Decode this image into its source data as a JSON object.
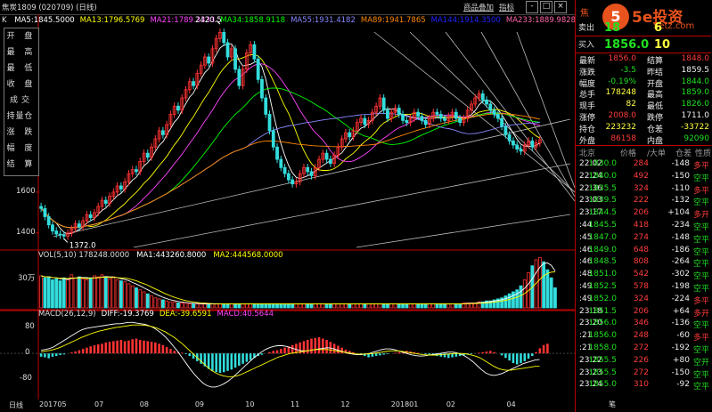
{
  "title_bar": {
    "symbol_label": "焦炭1809 (020709) (日线)",
    "right_links": [
      "商品叠加",
      "指标"
    ],
    "win_buttons": [
      "-",
      "□",
      "×"
    ]
  },
  "ma_legend": {
    "label": "K",
    "items": [
      {
        "text": "MA5:1845.5000",
        "color": "#ffffff"
      },
      {
        "text": "MA13:1796.5769",
        "color": "#ffff00"
      },
      {
        "text": "MA21:1789.3333",
        "color": "#ff44ff"
      },
      {
        "text": "MA34:1858.9118",
        "color": "#00ff00"
      },
      {
        "text": "MA55:1931.4182",
        "color": "#8888ff"
      },
      {
        "text": "MA89:1941.7865",
        "color": "#ff8800"
      },
      {
        "text": "MA144:1914.3500",
        "color": "#2222ff"
      },
      {
        "text": "MA233:1889.9828",
        "color": "#ff66aa"
      }
    ]
  },
  "left_menu": [
    "开 盘",
    "最 高",
    "最 低",
    "收 盘",
    "成交量",
    "持 仓",
    "涨 跌",
    "幅 度",
    "结 算"
  ],
  "logo": {
    "code": "焦",
    "mark": "5",
    "name": "5e投资",
    "url": "5etz.com"
  },
  "quote_header": {
    "sell_label": "卖出",
    "sell_price": "18",
    "sell_qty": "6",
    "buy_label": "买入",
    "buy_price": "1856.0",
    "buy_qty": "10"
  },
  "quote_rows": [
    {
      "l1": "最新",
      "v1": "1856.0",
      "c1": "red",
      "l2": "结算",
      "v2": "1848.0",
      "c2": "red"
    },
    {
      "l1": "涨跌",
      "v1": "-3.5",
      "c1": "grn",
      "l2": "昨结",
      "v2": "1859.5",
      "c2": "wht"
    },
    {
      "l1": "幅度",
      "v1": "-0.19%",
      "c1": "grn",
      "l2": "开盘",
      "v2": "1844.0",
      "c2": "grn"
    },
    {
      "l1": "总手",
      "v1": "178248",
      "c1": "yel",
      "l2": "最高",
      "v2": "1859.0",
      "c2": "grn"
    },
    {
      "l1": "现手",
      "v1": "82",
      "c1": "yel",
      "l2": "最低",
      "v2": "1826.0",
      "c2": "grn"
    },
    {
      "l1": "涨停",
      "v1": "2008.0",
      "c1": "red",
      "l2": "跌停",
      "v2": "1711.0",
      "c2": "wht"
    },
    {
      "l1": "持仓",
      "v1": "223232",
      "c1": "yel",
      "l2": "仓差",
      "v2": "-33722",
      "c2": "yel"
    },
    {
      "l1": "外盘",
      "v1": "86158",
      "c1": "red",
      "l2": "内盘",
      "v2": "92090",
      "c2": "grn"
    }
  ],
  "tick_header": {
    "place": "北京",
    "price": "价格",
    "qty": "/大单",
    "oi": "仓差",
    "nature": "性质"
  },
  "ticks": [
    {
      "time": "22:02",
      "price": "1830.0",
      "qty": "284",
      "oi": "-148",
      "nature": "多平"
    },
    {
      "time": "22:24",
      "price": "1840.0",
      "qty": "492",
      "oi": "-150",
      "nature": "空平"
    },
    {
      "time": "22:36",
      "price": "1835.5",
      "qty": "324",
      "oi": "-110",
      "nature": "多平"
    },
    {
      "time": "23:03",
      "price": "1839.5",
      "qty": "222",
      "oi": "-132",
      "nature": "空平"
    },
    {
      "time": "23:17",
      "price": "1844.5",
      "qty": "206",
      "oi": "+104",
      "nature": "多开"
    },
    {
      "time": ":44",
      "price": "1845.5",
      "qty": "418",
      "oi": "-234",
      "nature": "空平"
    },
    {
      "time": ":45",
      "price": "1847.0",
      "qty": "274",
      "oi": "-148",
      "nature": "空平"
    },
    {
      "time": ":46",
      "price": "1849.0",
      "qty": "648",
      "oi": "-186",
      "nature": "空平"
    },
    {
      "time": ":46",
      "price": "1848.5",
      "qty": "808",
      "oi": "-264",
      "nature": "空平"
    },
    {
      "time": ":48",
      "price": "1851.0",
      "qty": "542",
      "oi": "-302",
      "nature": "空平"
    },
    {
      "time": ":49",
      "price": "1852.5",
      "qty": "578",
      "oi": "-198",
      "nature": "空平"
    },
    {
      "time": ":49",
      "price": "1852.0",
      "qty": "324",
      "oi": "-224",
      "nature": "多平"
    },
    {
      "time": "23:18",
      "price": "1851.5",
      "qty": "206",
      "oi": "+64",
      "nature": "多开"
    },
    {
      "time": "23:20",
      "price": "1856.0",
      "qty": "346",
      "oi": "-136",
      "nature": "空平"
    },
    {
      "time": ":21",
      "price": "1856.0",
      "qty": "248",
      "oi": "-60",
      "nature": "多平"
    },
    {
      "time": ":21",
      "price": "1858.0",
      "qty": "272",
      "oi": "-192",
      "nature": "空平"
    },
    {
      "time": "23:22",
      "price": "1855.5",
      "qty": "226",
      "oi": "+80",
      "nature": "空开"
    },
    {
      "time": "23:23",
      "price": "1855.5",
      "qty": "272",
      "oi": "-150",
      "nature": "空平"
    },
    {
      "time": "23:24",
      "price": "1855.0",
      "qty": "310",
      "oi": "-92",
      "nature": "空平"
    }
  ],
  "vol_legend": [
    {
      "text": "VOL(5,10) 178248.0000",
      "color": "#dddddd"
    },
    {
      "text": "MA1:443260.8000",
      "color": "#ffffff"
    },
    {
      "text": "MA2:444568.0000",
      "color": "#ffff00"
    }
  ],
  "macd_legend": [
    {
      "text": "MACD(26,12,9)",
      "color": "#dddddd"
    },
    {
      "text": "DIFF:-19.3769",
      "color": "#ffffff"
    },
    {
      "text": "DEA:-39.6591",
      "color": "#ffff00"
    },
    {
      "text": "MACD:40.5644",
      "color": "#ff44ff"
    }
  ],
  "x_axis": {
    "label": "日线",
    "ticks": [
      "201705",
      "07",
      "08",
      "09",
      "10",
      "11",
      "12",
      "201801",
      "02",
      "04"
    ]
  },
  "bottom_right": "笔",
  "chart_data": {
    "type": "candlestick",
    "price_axis": {
      "ticks": [
        1400,
        1600
      ],
      "ylim": [
        1330,
        2460
      ]
    },
    "annotations": [
      {
        "text": "2420.5",
        "value": 2420.5,
        "kind": "high"
      },
      {
        "text": "1372.0",
        "value": 1372.0,
        "kind": "low"
      }
    ],
    "close": [
      1520,
      1480,
      1440,
      1410,
      1395,
      1390,
      1385,
      1400,
      1420,
      1445,
      1430,
      1460,
      1490,
      1475,
      1500,
      1530,
      1560,
      1545,
      1580,
      1600,
      1630,
      1615,
      1650,
      1690,
      1710,
      1700,
      1750,
      1790,
      1770,
      1820,
      1860,
      1900,
      1880,
      1930,
      1980,
      2020,
      2000,
      2060,
      2100,
      2140,
      2120,
      2180,
      2220,
      2260,
      2230,
      2300,
      2350,
      2380,
      2330,
      2260,
      2300,
      2200,
      2120,
      2200,
      2280,
      2320,
      2250,
      2150,
      2060,
      1980,
      1900,
      1820,
      1760,
      1720,
      1690,
      1660,
      1640,
      1650,
      1690,
      1720,
      1700,
      1680,
      1720,
      1760,
      1790,
      1760,
      1740,
      1780,
      1820,
      1860,
      1890,
      1870,
      1900,
      1940,
      1960,
      1930,
      1950,
      1990,
      2020,
      2060,
      2000,
      1960,
      1990,
      2010,
      1980,
      1950,
      1940,
      1960,
      1990,
      1970,
      1950,
      1930,
      1960,
      1990,
      1980,
      1960,
      1950,
      1970,
      1990,
      1960,
      1940,
      1960,
      2000,
      2030,
      2060,
      2080,
      2050,
      2030,
      2000,
      1980,
      1960,
      1920,
      1880,
      1850,
      1830,
      1810,
      1800,
      1830,
      1850,
      1820,
      1840,
      1856
    ],
    "volume_axis": {
      "ticks": [
        "30万"
      ],
      "tick_value_wan": 30
    },
    "volume": [
      32,
      30,
      31,
      28,
      29,
      27,
      30,
      28,
      33,
      30,
      31,
      29,
      28,
      30,
      32,
      31,
      33,
      30,
      29,
      31,
      28,
      27,
      26,
      24,
      22,
      20,
      18,
      16,
      14,
      12,
      10,
      9,
      8,
      7,
      6,
      6,
      5,
      5,
      5,
      4,
      4,
      4,
      4,
      4,
      4,
      4,
      4,
      4,
      4,
      4,
      4,
      4,
      4,
      4,
      4,
      4,
      4,
      4,
      4,
      4,
      4,
      4,
      4,
      4,
      4,
      4,
      4,
      4,
      4,
      4,
      4,
      4,
      4,
      4,
      4,
      4,
      4,
      4,
      4,
      4,
      4,
      4,
      4,
      4,
      4,
      4,
      4,
      4,
      4,
      4,
      4,
      4,
      4,
      4,
      4,
      4,
      4,
      4,
      4,
      4,
      4,
      4,
      4,
      4,
      4,
      4,
      4,
      4,
      4,
      4,
      4,
      5,
      5,
      5,
      5,
      6,
      6,
      7,
      7,
      8,
      9,
      10,
      12,
      14,
      16,
      18,
      22,
      28,
      35,
      42,
      48,
      50,
      46,
      38,
      30,
      20
    ],
    "macd_axis": {
      "ticks": [
        80,
        0,
        -80
      ],
      "ylim": [
        -140,
        130
      ]
    },
    "macd_hist": [
      -10,
      -12,
      -15,
      -10,
      -8,
      -5,
      -3,
      0,
      3,
      6,
      10,
      14,
      18,
      22,
      25,
      28,
      30,
      34,
      36,
      38,
      40,
      42,
      38,
      40,
      44,
      46,
      42,
      40,
      38,
      36,
      34,
      30,
      26,
      20,
      14,
      8,
      4,
      2,
      -2,
      -8,
      -16,
      -24,
      -32,
      -40,
      -48,
      -54,
      -58,
      -60,
      -58,
      -54,
      -50,
      -44,
      -38,
      -32,
      -26,
      -20,
      -14,
      -8,
      -4,
      0,
      4,
      8,
      10,
      14,
      18,
      22,
      26,
      30,
      34,
      38,
      42,
      46,
      48,
      50,
      46,
      42,
      36,
      30,
      24,
      18,
      12,
      8,
      4,
      0,
      -4,
      -8,
      -12,
      -10,
      -8,
      -6,
      -4,
      -2,
      0,
      2,
      4,
      6,
      8,
      6,
      4,
      2,
      0,
      -2,
      -4,
      -6,
      -8,
      -10,
      -12,
      -14,
      -12,
      -10,
      -8,
      -6,
      -4,
      -2,
      0,
      2,
      4,
      6,
      8,
      4,
      0,
      -6,
      -14,
      -22,
      -30,
      -34,
      -30,
      -24,
      -16,
      -8,
      4,
      16,
      26,
      30
    ],
    "diff": [
      10,
      12,
      15,
      20,
      28,
      36,
      44,
      52,
      60,
      68,
      74,
      78,
      80,
      82,
      84,
      86,
      88,
      90,
      92,
      92,
      94,
      96,
      96,
      94,
      92,
      90,
      86,
      80,
      72,
      62,
      50,
      36,
      20,
      4,
      -14,
      -32,
      -50,
      -66,
      -80,
      -92,
      -100,
      -104,
      -104,
      -100,
      -94,
      -86,
      -76,
      -64,
      -52,
      -40,
      -28,
      -16,
      -6,
      4,
      12,
      18,
      22,
      24,
      24,
      22,
      18,
      14,
      10,
      8,
      8,
      10,
      12,
      14,
      16,
      18,
      16,
      12,
      8,
      4,
      0,
      -2,
      -4,
      -4,
      -2,
      0,
      4,
      8,
      12,
      14,
      14,
      12,
      8,
      4,
      0,
      -4,
      -6,
      -8,
      -8,
      -6,
      -4,
      -2,
      0,
      2,
      4,
      4,
      2,
      -2,
      -8,
      -16,
      -26,
      -38,
      -50,
      -60,
      -66,
      -68,
      -66,
      -62,
      -56,
      -50,
      -44,
      -38,
      -32,
      -28,
      -24,
      -20,
      -19
    ],
    "dea": [
      5,
      7,
      9,
      12,
      16,
      21,
      27,
      33,
      39,
      45,
      51,
      56,
      61,
      65,
      69,
      72,
      75,
      78,
      80,
      82,
      84,
      86,
      88,
      88,
      88,
      87,
      85,
      82,
      78,
      72,
      66,
      58,
      50,
      40,
      30,
      18,
      6,
      -6,
      -18,
      -30,
      -42,
      -52,
      -60,
      -66,
      -70,
      -72,
      -72,
      -70,
      -66,
      -60,
      -54,
      -48,
      -42,
      -36,
      -30,
      -24,
      -18,
      -12,
      -8,
      -4,
      0,
      2,
      4,
      6,
      8,
      10,
      12,
      12,
      12,
      12,
      10,
      8,
      6,
      4,
      2,
      0,
      -2,
      -2,
      -2,
      -1,
      0,
      2,
      4,
      6,
      8,
      8,
      8,
      6,
      4,
      2,
      0,
      -2,
      -4,
      -5,
      -5,
      -5,
      -4,
      -3,
      -2,
      -1,
      0,
      0,
      -1,
      -3,
      -6,
      -10,
      -16,
      -24,
      -32,
      -40,
      -46,
      -50,
      -52,
      -52,
      -50,
      -48,
      -46,
      -44,
      -42,
      -40,
      -40
    ]
  }
}
